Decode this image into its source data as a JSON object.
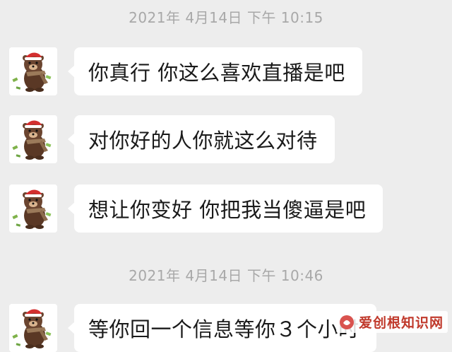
{
  "timestamps": [
    "2021年 4月14日 下午 10:15",
    "2021年 4月14日 下午 10:46"
  ],
  "messages": [
    {
      "text": "你真行 你这么喜欢直播是吧",
      "avatar_icon": "bear-santa-hat-avatar-icon"
    },
    {
      "text": "对你好的人你就这么对待",
      "avatar_icon": "bear-santa-hat-avatar-icon"
    },
    {
      "text": "想让你变好 你把我当傻逼是吧",
      "avatar_icon": "bear-santa-hat-avatar-icon"
    },
    {
      "text": "等你回一个信息等你３个小时",
      "avatar_icon": "bear-santa-hat-avatar-icon"
    }
  ],
  "watermark": {
    "text": "爱创根知识网",
    "logo_color": "#d9534f"
  },
  "colors": {
    "background": "#ededed",
    "bubble": "#ffffff",
    "timestamp": "#a8a8a8",
    "bear": "#5a3825",
    "hat": "#d32f2f"
  }
}
